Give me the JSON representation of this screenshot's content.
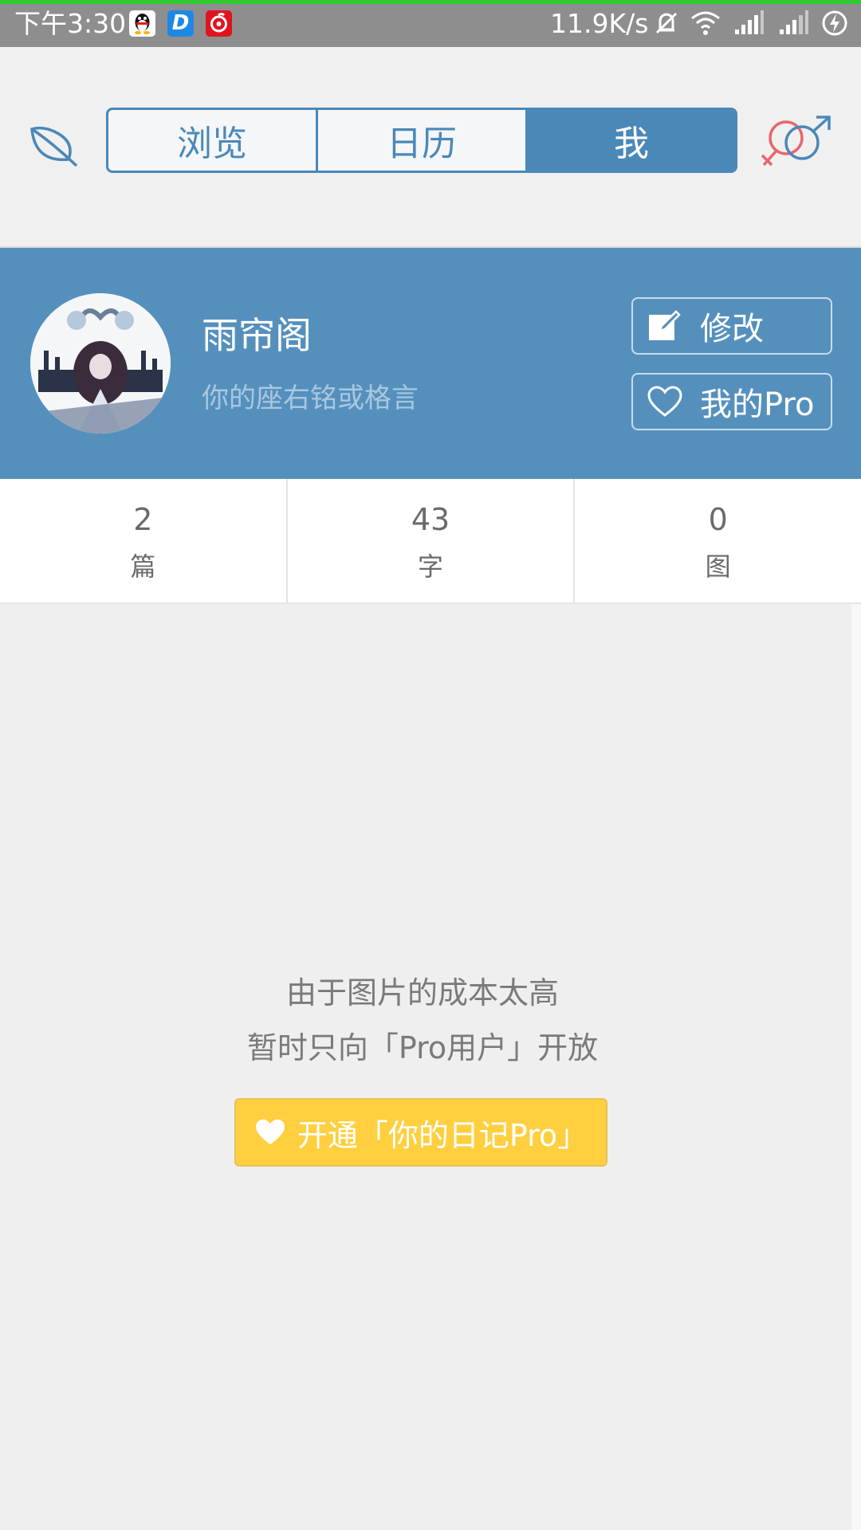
{
  "status_bar": {
    "time": "下午3:30",
    "net_speed": "11.9K/s",
    "app_icons": [
      "qq-icon",
      "d-app-icon",
      "netease-music-icon"
    ],
    "d_app_letter": "D",
    "system_icons": [
      "mute-bell-icon",
      "wifi-icon",
      "signal-icon",
      "signal-icon",
      "charging-icon"
    ]
  },
  "nav": {
    "tabs": [
      {
        "label": "浏览",
        "active": false
      },
      {
        "label": "日历",
        "active": false
      },
      {
        "label": "我",
        "active": true
      }
    ],
    "left_icon": "leaf-icon",
    "right_icon": "gender-icon"
  },
  "profile": {
    "name": "雨帘阁",
    "motto_placeholder": "你的座右铭或格言",
    "edit_label": "修改",
    "pro_label": "我的Pro"
  },
  "stats": [
    {
      "value": "2",
      "label": "篇"
    },
    {
      "value": "43",
      "label": "字"
    },
    {
      "value": "0",
      "label": "图"
    }
  ],
  "notice": {
    "line1": "由于图片的成本太高",
    "line2": "暂时只向「Pro用户」开放",
    "button": "开通「你的日记Pro」"
  },
  "colors": {
    "primary": "#4a88b8",
    "header_bg": "#5590bd",
    "promo": "#ffcf3f",
    "status_bar": "#8e8e8e"
  }
}
